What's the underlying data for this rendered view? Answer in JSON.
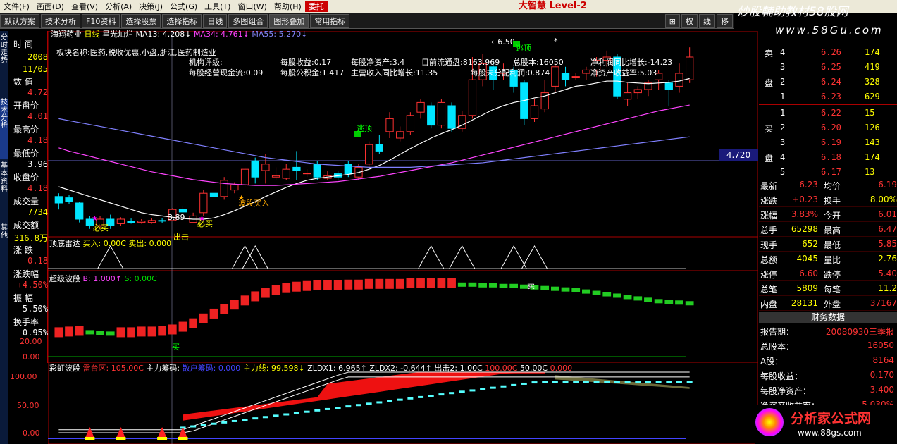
{
  "menu": [
    "文件(F)",
    "画面(D)",
    "查看(V)",
    "分析(A)",
    "决策(J)",
    "公式(G)",
    "工具(T)",
    "窗口(W)",
    "帮助(H)",
    "委托"
  ],
  "brand": "大智慧 Level-2",
  "watermark": {
    "line1": "炒股輔助教材58股网",
    "line2": "www.58Gu.com"
  },
  "toolbar": {
    "buttons": [
      "默认方案",
      "技术分析",
      "F10资料",
      "选择股票",
      "选择指标",
      "日线",
      "多图组合",
      "图形叠加",
      "常用指标"
    ],
    "right": [
      "⊞",
      "权",
      "线",
      "移"
    ]
  },
  "leftnav": [
    "分时走势",
    "技术分析",
    "基本资料",
    "其他"
  ],
  "header": {
    "stock": "海翔药业",
    "period": "日线",
    "indicator": "星光灿烂",
    "ma13": "MA13: 4.208↓",
    "ma34": "MA34: 4.761↓",
    "ma55": "MA55: 5.270↓"
  },
  "info": {
    "time_label": "时  间",
    "year": "2008",
    "date": "11/05",
    "value_label": "数  值",
    "value": "4.72",
    "open_label": "开盘价",
    "open": "4.01",
    "high_label": "最高价",
    "high": "4.18",
    "low_label": "最低价",
    "low": "3.96",
    "close_label": "收盘价",
    "close": "4.18",
    "vol_label": "成交量",
    "vol": "7734",
    "amt_label": "成交额",
    "amt": "316.8万",
    "chg_label": "涨  跌",
    "chg": "+0.18",
    "pct_label": "涨跌幅",
    "pct": "+4.50%",
    "amp_label": "振  幅",
    "amp": "5.50%",
    "turn_label": "换手率",
    "turn": "0.95%"
  },
  "fundamentals": {
    "sector": "板块名称:医药,税收优惠,小盘,浙江,医药制造业",
    "rating": "机构评级:",
    "cashflow": "每股经营现金流:0.09",
    "eps": "每股收益:0.17",
    "reserve": "每股公积金:1.417",
    "nav": "每股净资产:3.4",
    "rev_growth": "主营收入同比增长:11.35",
    "float_share": "目前流通盘:8163.969",
    "total_share": "总股本:16050",
    "undist": "每股未分配利润:0.874",
    "profit_growth": "净利润同比增长:-14.23",
    "roe": "净资产收益率:5.03"
  },
  "annotations": {
    "peak": "←6.50",
    "sell": "逃顶",
    "buy": "必买",
    "wave_buy": "波段买入",
    "low": "3.89",
    "chuji": "出击",
    "sell_mark": "卖",
    "buy_mark": "买",
    "star": "*"
  },
  "price_tag": "4.720",
  "panel2": {
    "title": "顶底雷达",
    "buy": "买入: 0.00C",
    "sell": "卖出: 0.000"
  },
  "panel3": {
    "title": "超级波段",
    "b": "B: 1.000↑",
    "s": "S: 0.00C",
    "y1": "20.00",
    "y2": "0.00"
  },
  "panel4": {
    "title": "彩虹波段",
    "a": "雷台区: 105.00C",
    "b": "主力筹码:",
    "c": "散户筹码:",
    "d": "0.000",
    "e": "主力线: 99.598↓",
    "f": "ZLDX1: 6.965↑",
    "g": "ZLDX2: -0.644↑",
    "h": "出击2: 1.00C",
    "i": "100.00C",
    "j": "50.00C",
    "k": "0.000",
    "y1": "100.00",
    "y2": "50.00",
    "y3": "0.00"
  },
  "orderbook": {
    "sell_label": [
      "卖",
      "盘"
    ],
    "buy_label": [
      "买",
      "盘"
    ],
    "sell": [
      {
        "n": "4",
        "p": "6.26",
        "v": "174"
      },
      {
        "n": "3",
        "p": "6.25",
        "v": "419"
      },
      {
        "n": "2",
        "p": "6.24",
        "v": "328"
      },
      {
        "n": "1",
        "p": "6.23",
        "v": "629"
      }
    ],
    "buy": [
      {
        "n": "1",
        "p": "6.22",
        "v": "15"
      },
      {
        "n": "2",
        "p": "6.20",
        "v": "126"
      },
      {
        "n": "3",
        "p": "6.19",
        "v": "143"
      },
      {
        "n": "4",
        "p": "6.18",
        "v": "174"
      },
      {
        "n": "5",
        "p": "6.17",
        "v": "13"
      }
    ]
  },
  "stats": [
    {
      "l1": "最新",
      "v1": "6.23",
      "l2": "均价",
      "v2": "6.19"
    },
    {
      "l1": "涨跌",
      "v1": "+0.23",
      "l2": "换手",
      "v2": "8.00%"
    },
    {
      "l1": "涨幅",
      "v1": "3.83%",
      "l2": "今开",
      "v2": "6.01"
    },
    {
      "l1": "总手",
      "v1": "65298",
      "l2": "最高",
      "v2": "6.47"
    },
    {
      "l1": "现手",
      "v1": "652",
      "l2": "最低",
      "v2": "5.85"
    },
    {
      "l1": "总额",
      "v1": "4045",
      "l2": "量比",
      "v2": "2.76"
    },
    {
      "l1": "涨停",
      "v1": "6.60",
      "l2": "跌停",
      "v2": "5.40"
    },
    {
      "l1": "总笔",
      "v1": "5809",
      "l2": "每笔",
      "v2": "11.2"
    },
    {
      "l1": "内盘",
      "v1": "28131",
      "l2": "外盘",
      "v2": "37167"
    }
  ],
  "finance": {
    "title": "财务数据",
    "rows": [
      {
        "k": "报告期：",
        "v": "20080930三季报"
      },
      {
        "k": "总股本：",
        "v": "16050"
      },
      {
        "k": "A股：",
        "v": "8164"
      },
      {
        "k": "每股收益：",
        "v": "0.170"
      },
      {
        "k": "每股净资产：",
        "v": "3.400"
      },
      {
        "k": "净资产收益率：",
        "v": "5.030%"
      }
    ]
  },
  "logo": {
    "text": "分析家公式网",
    "url": "www.88gs.com"
  },
  "colors": {
    "up": "#ff3232",
    "down": "#00e5ff",
    "ma1": "#ffffff",
    "ma2": "#ff44ff",
    "ma3": "#8080ff",
    "yellow": "#ffff00",
    "green": "#00d000"
  },
  "chart_data": {
    "type": "candlestick",
    "candles": [
      [
        4.3,
        4.2,
        4.35,
        4.1
      ],
      [
        4.28,
        4.22,
        4.32,
        4.18
      ],
      [
        4.2,
        3.95,
        4.22,
        3.9
      ],
      [
        3.95,
        3.85,
        4.0,
        3.8
      ],
      [
        3.85,
        3.95,
        4.0,
        3.82
      ],
      [
        3.95,
        3.85,
        4.02,
        3.8
      ],
      [
        3.88,
        3.95,
        3.98,
        3.85
      ],
      [
        3.92,
        3.9,
        3.96,
        3.88
      ],
      [
        3.9,
        3.92,
        3.95,
        3.88
      ],
      [
        3.9,
        3.93,
        3.96,
        3.88
      ],
      [
        3.93,
        3.92,
        3.97,
        3.89
      ],
      [
        3.93,
        4.1,
        4.12,
        3.92
      ],
      [
        4.1,
        4.06,
        4.15,
        4.03
      ],
      [
        3.9,
        4.0,
        4.05,
        3.89
      ],
      [
        4.05,
        4.35,
        4.4,
        4.0
      ],
      [
        4.35,
        4.3,
        4.4,
        4.25
      ],
      [
        4.3,
        4.55,
        4.6,
        4.25
      ],
      [
        4.4,
        4.48,
        4.52,
        4.35
      ],
      [
        4.48,
        4.72,
        4.75,
        4.45
      ],
      [
        4.85,
        4.6,
        4.9,
        4.5
      ],
      [
        4.7,
        4.8,
        4.95,
        4.5
      ],
      [
        4.6,
        4.62,
        4.75,
        4.55
      ],
      [
        4.58,
        4.72,
        4.8,
        4.55
      ],
      [
        4.75,
        4.7,
        5.0,
        4.55
      ],
      [
        4.65,
        4.66,
        4.72,
        4.6
      ],
      [
        4.8,
        4.6,
        4.85,
        4.55
      ],
      [
        4.58,
        4.62,
        4.7,
        4.55
      ],
      [
        4.65,
        4.6,
        4.7,
        4.55
      ],
      [
        4.8,
        4.65,
        4.85,
        4.6
      ],
      [
        4.6,
        4.75,
        4.8,
        4.55
      ],
      [
        4.8,
        5.1,
        5.15,
        4.75
      ],
      [
        5.1,
        5.0,
        5.25,
        4.95
      ],
      [
        5.3,
        5.5,
        5.6,
        5.2
      ],
      [
        5.2,
        5.3,
        5.38,
        5.15
      ],
      [
        5.3,
        5.55,
        5.6,
        5.25
      ],
      [
        5.6,
        5.75,
        5.8,
        5.5
      ],
      [
        5.7,
        5.4,
        5.75,
        5.35
      ],
      [
        5.4,
        5.75,
        5.8,
        5.35
      ],
      [
        5.7,
        5.35,
        5.75,
        5.3
      ],
      [
        5.35,
        5.55,
        5.62,
        5.3
      ],
      [
        5.55,
        6.1,
        6.45,
        5.5
      ],
      [
        6.1,
        6.35,
        6.5,
        6.0
      ],
      [
        6.3,
        6.1,
        6.4,
        5.95
      ],
      [
        6.2,
        6.25,
        6.35,
        6.1
      ],
      [
        6.25,
        6.0,
        6.3,
        5.9
      ],
      [
        6.05,
        5.5,
        6.1,
        5.4
      ],
      [
        5.5,
        5.7,
        5.8,
        5.45
      ],
      [
        5.65,
        5.9,
        6.1,
        5.6
      ],
      [
        6.0,
        6.3,
        6.35,
        5.9
      ],
      [
        6.2,
        6.1,
        6.3,
        6.0
      ],
      [
        6.15,
        6.15,
        6.2,
        6.1
      ],
      [
        6.2,
        6.25,
        6.3,
        6.1
      ],
      [
        6.25,
        6.4,
        6.45,
        6.15
      ],
      [
        6.4,
        6.45,
        6.55,
        6.3
      ],
      [
        6.45,
        5.85,
        6.5,
        5.8
      ],
      [
        5.8,
        5.9,
        6.05,
        5.7
      ],
      [
        5.9,
        5.95,
        6.0,
        5.8
      ],
      [
        5.95,
        6.05,
        6.1,
        5.85
      ],
      [
        6.1,
        6.2,
        6.25,
        5.95
      ],
      [
        6.05,
        5.95,
        6.1,
        5.7
      ],
      [
        6.0,
        6.2,
        6.35,
        5.9
      ],
      [
        6.1,
        6.45,
        6.6,
        6.05
      ]
    ],
    "ma13": [
      4.45,
      4.4,
      4.35,
      4.3,
      4.25,
      4.2,
      4.15,
      4.1,
      4.05,
      4.02,
      4.0,
      3.98,
      3.96,
      3.95,
      3.95,
      3.97,
      4.02,
      4.08,
      4.15,
      4.22,
      4.3,
      4.37,
      4.44,
      4.5,
      4.55,
      4.58,
      4.6,
      4.62,
      4.64,
      4.67,
      4.72,
      4.78,
      4.86,
      4.95,
      5.04,
      5.12,
      5.2,
      5.27,
      5.33,
      5.4,
      5.48,
      5.56,
      5.64,
      5.7,
      5.75,
      5.78,
      5.82,
      5.85,
      5.9,
      5.95,
      6.0,
      6.02,
      6.05,
      6.08,
      6.08,
      6.06,
      6.05,
      6.04,
      6.05,
      6.06,
      6.08,
      6.12
    ],
    "ma34": [
      5.05,
      5.0,
      4.96,
      4.92,
      4.88,
      4.84,
      4.8,
      4.76,
      4.72,
      4.68,
      4.65,
      4.62,
      4.59,
      4.56,
      4.54,
      4.52,
      4.5,
      4.49,
      4.48,
      4.47,
      4.47,
      4.47,
      4.48,
      4.49,
      4.5,
      4.51,
      4.52,
      4.53,
      4.55,
      4.57,
      4.59,
      4.61,
      4.64,
      4.67,
      4.7,
      4.73,
      4.76,
      4.79,
      4.82,
      4.86,
      4.9,
      4.94,
      4.98,
      5.02,
      5.06,
      5.1,
      5.14,
      5.18,
      5.22,
      5.26,
      5.3,
      5.34,
      5.38,
      5.42,
      5.46,
      5.5,
      5.54,
      5.58,
      5.62,
      5.65,
      5.68,
      5.71
    ],
    "ma55": [
      5.5,
      5.47,
      5.44,
      5.41,
      5.38,
      5.35,
      5.32,
      5.29,
      5.26,
      5.23,
      5.2,
      5.17,
      5.14,
      5.11,
      5.08,
      5.05,
      5.02,
      4.99,
      4.96,
      4.93,
      4.9,
      4.88,
      4.86,
      4.84,
      4.82,
      4.8,
      4.79,
      4.78,
      4.77,
      4.76,
      4.75,
      4.75,
      4.75,
      4.75,
      4.75,
      4.76,
      4.77,
      4.78,
      4.79,
      4.8,
      4.81,
      4.82,
      4.84,
      4.86,
      4.88,
      4.9,
      4.92,
      4.94,
      4.96,
      4.98,
      5.0,
      5.02,
      5.04,
      5.06,
      5.08,
      5.1,
      5.12,
      5.14,
      5.16,
      5.18,
      5.2,
      5.22
    ],
    "radar_peaks": [
      5,
      18,
      19,
      36,
      39,
      44,
      46
    ],
    "wave": [
      20,
      21,
      22,
      21,
      20,
      19,
      20,
      20,
      21,
      21,
      22,
      24,
      28,
      33,
      40,
      47,
      54,
      60,
      66,
      72,
      77,
      81,
      84,
      86,
      87,
      88,
      88,
      88,
      89,
      89,
      90,
      90,
      90,
      90,
      91,
      91,
      91,
      91,
      91,
      90,
      90,
      89,
      89,
      88,
      88,
      87,
      86,
      85,
      84,
      83,
      82,
      80,
      78,
      76,
      74,
      72,
      70,
      68,
      66,
      65,
      64,
      63
    ],
    "y_range": [
      3.7,
      6.7
    ]
  }
}
